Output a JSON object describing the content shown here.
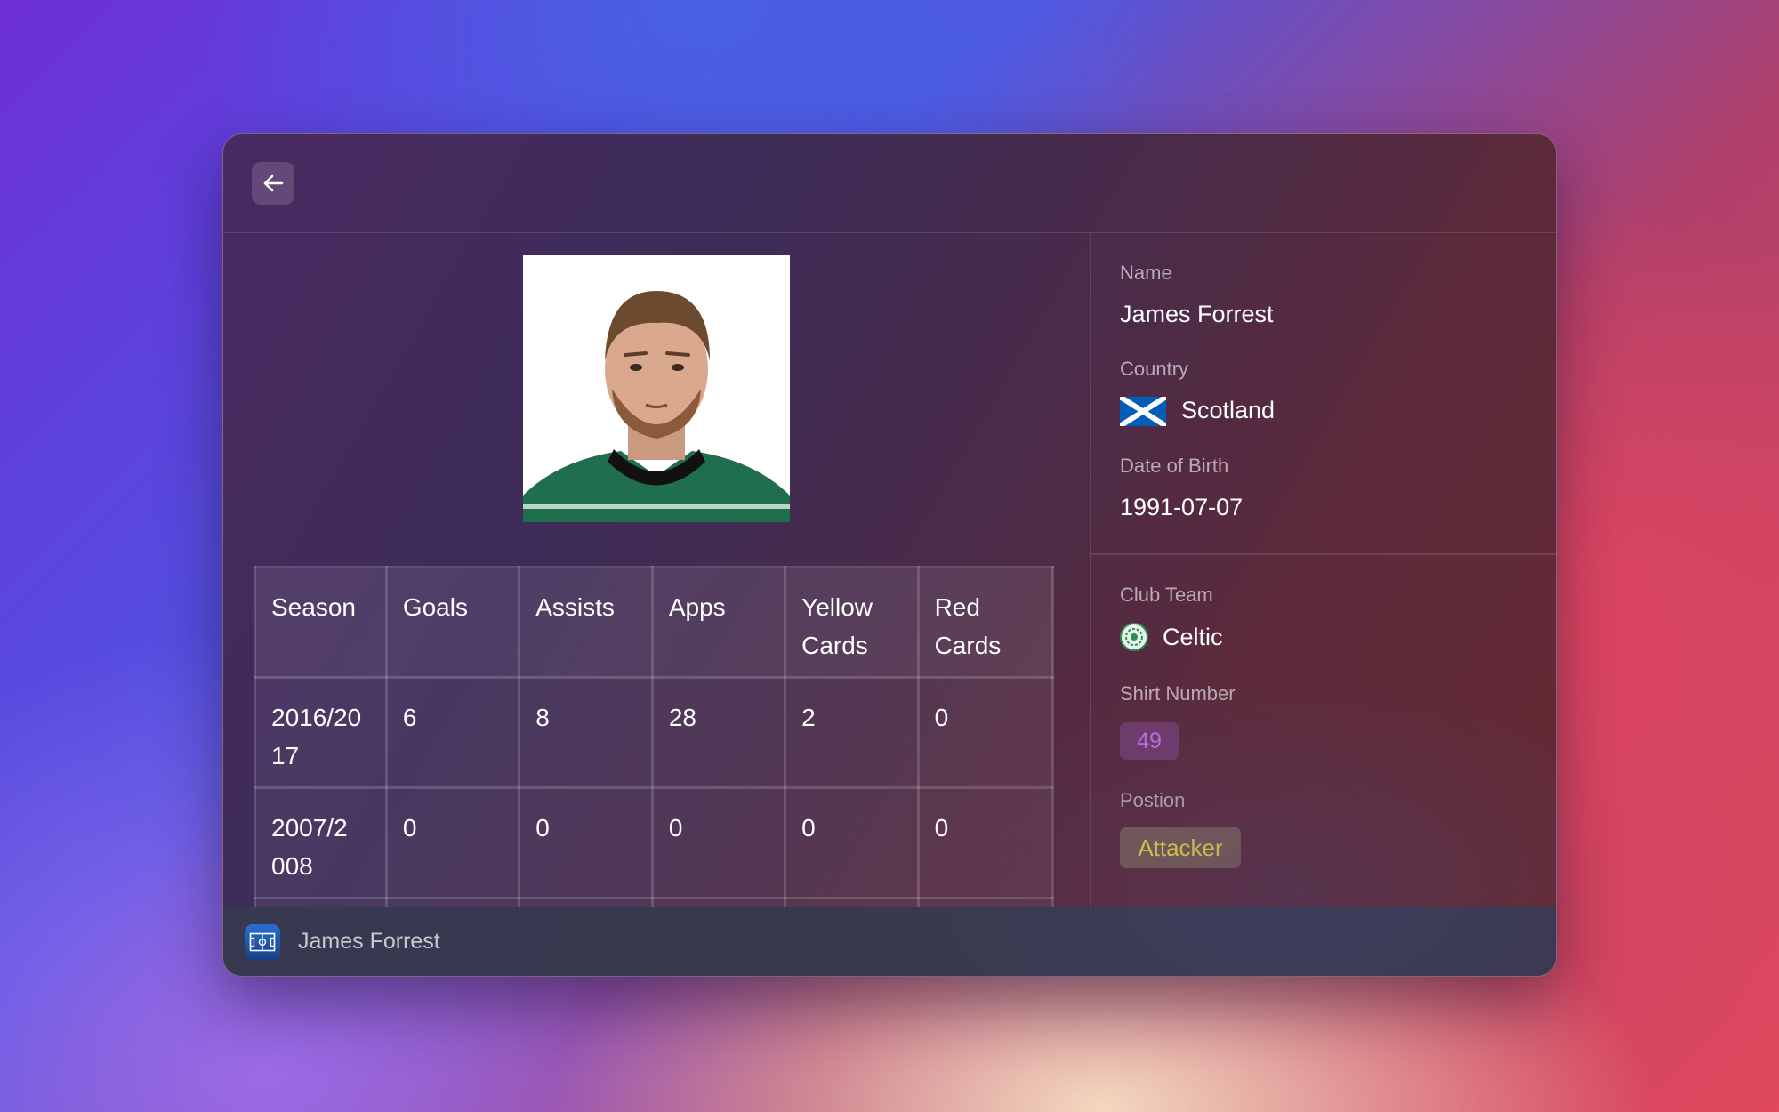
{
  "window": {
    "footer_title": "James Forrest"
  },
  "toolbar": {
    "back_icon": "arrow-left-icon"
  },
  "stats_table": {
    "headers": [
      "Season",
      "Goals",
      "Assists",
      "Apps",
      "Yellow Cards",
      "Red Cards"
    ],
    "rows": [
      [
        "2016/2017",
        "6",
        "8",
        "28",
        "2",
        "0"
      ],
      [
        "2007/2008",
        "0",
        "0",
        "0",
        "0",
        "0"
      ]
    ]
  },
  "player": {
    "name_label": "Name",
    "name": "James Forrest",
    "country_label": "Country",
    "country": "Scotland",
    "dob_label": "Date of Birth",
    "dob": "1991-07-07",
    "club_label": "Club Team",
    "club": "Celtic",
    "shirt_label": "Shirt Number",
    "shirt_number": "49",
    "position_label": "Postion",
    "position": "Attacker"
  },
  "colors": {
    "flag_blue": "#005eb8",
    "club_green": "#2e8b57",
    "badge_purple_text": "#c06ee0",
    "badge_yellow_text": "#f3dc45"
  }
}
